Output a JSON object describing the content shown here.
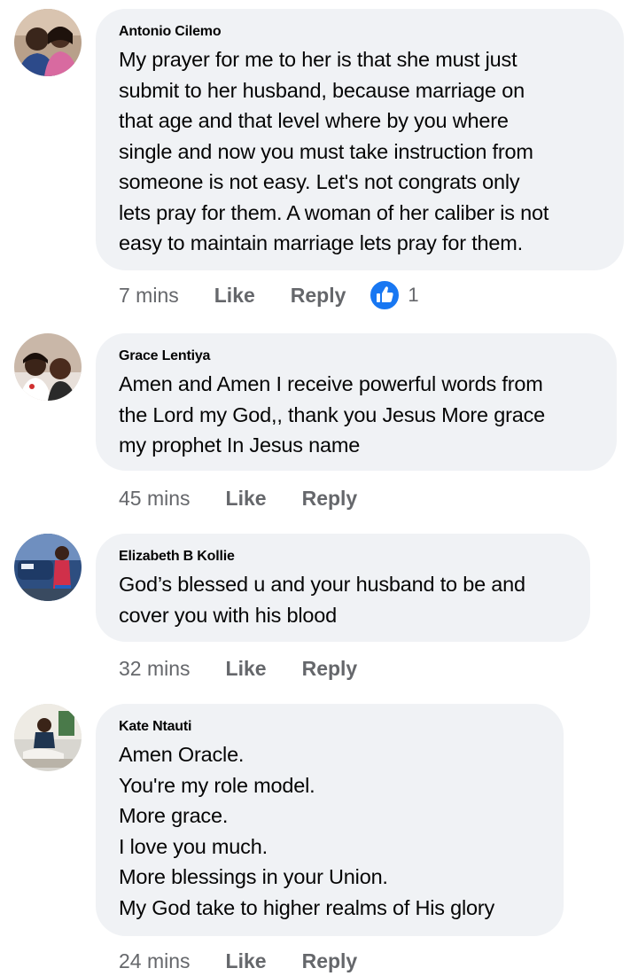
{
  "colors": {
    "bubble": "#f0f2f5",
    "meta_text": "#65676b",
    "like_blue": "#1877f2"
  },
  "comments": [
    {
      "author": "Antonio Cilemo",
      "text": "My prayer for me to her is that she must just\nsubmit to her husband, because marriage on\nthat age and that level where by you where\nsingle and now you must take instruction from\nsomeone is not easy. Let's not congrats only\nlets pray for them. A woman of her caliber is not\neasy to maintain marriage lets pray for them.",
      "time": "7 mins",
      "like_label": "Like",
      "reply_label": "Reply",
      "reaction_icon": "thumbs-up-icon",
      "reaction_count": "1"
    },
    {
      "author": "Grace Lentiya",
      "text": "Amen and Amen I receive powerful words from\nthe Lord my God,, thank you Jesus More grace\nmy prophet In Jesus name",
      "time": "45 mins",
      "like_label": "Like",
      "reply_label": "Reply"
    },
    {
      "author": "Elizabeth B Kollie",
      "text": "God’s blessed u and your husband to be and\ncover you with his blood",
      "time": "32 mins",
      "like_label": "Like",
      "reply_label": "Reply"
    },
    {
      "author": "Kate Ntauti",
      "text": "Amen Oracle.\nYou're my role model.\nMore grace.\nI love you much.\nMore blessings in your Union.\nMy God take to higher realms of His glory",
      "time": "24 mins",
      "like_label": "Like",
      "reply_label": "Reply"
    }
  ]
}
